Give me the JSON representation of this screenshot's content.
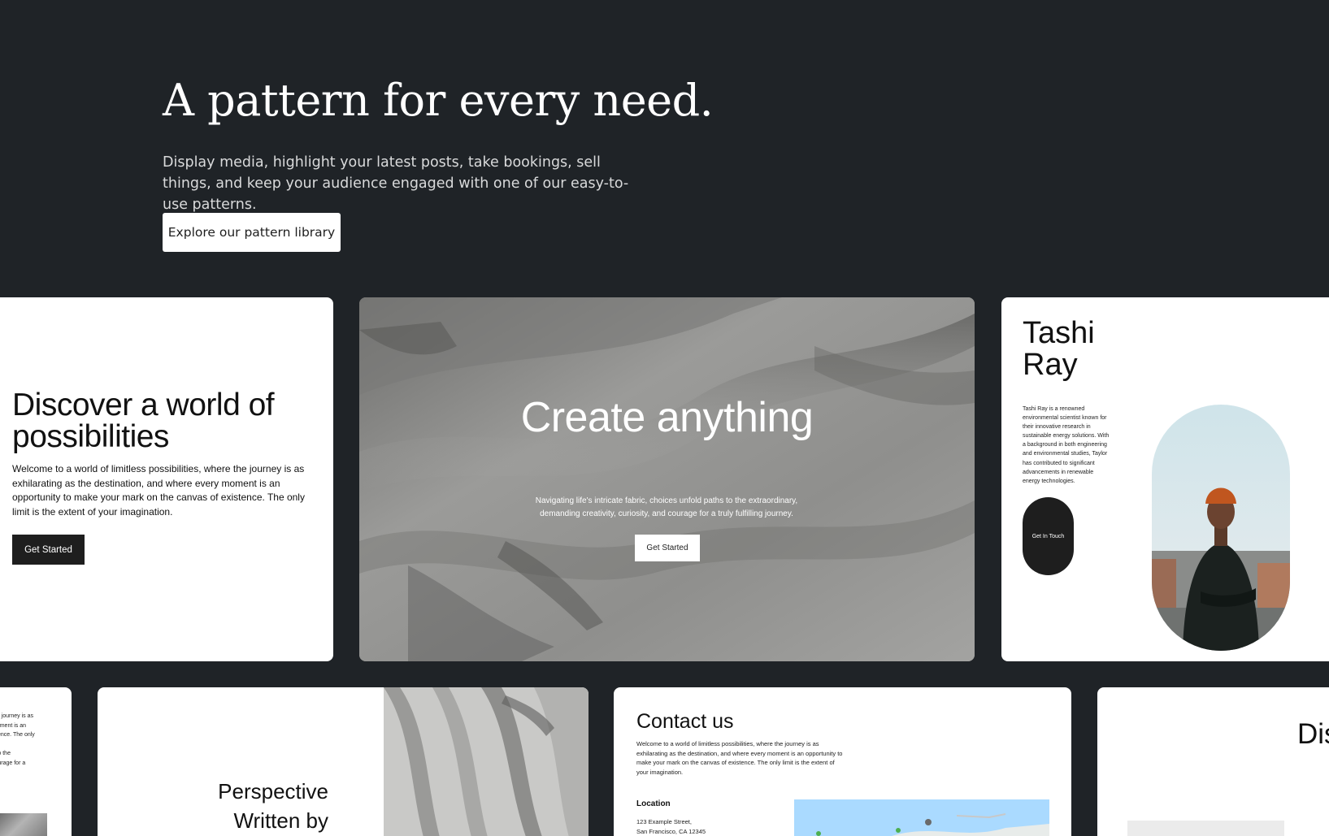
{
  "hero": {
    "title": "A pattern for every need.",
    "description": "Display media, highlight your latest posts, take bookings, sell things, and keep your audience engaged with one of our easy-to-use patterns.",
    "button_label": "Explore our pattern library"
  },
  "patterns": {
    "discover": {
      "title": "Discover a world of possibilities",
      "body": "Welcome to a world of limitless possibilities, where the journey is as exhilarating as the destination, and where every moment is an opportunity to make your mark on the canvas of existence. The only limit is the extent of your imagination.",
      "button_label": "Get Started"
    },
    "create": {
      "title": "Create anything",
      "body": "Navigating life's intricate fabric, choices unfold paths to the extraordinary, demanding creativity, curiosity, and courage for a truly fulfilling journey.",
      "button_label": "Get Started"
    },
    "profile": {
      "name": "Tashi Ray",
      "bio": "Tashi Ray is a renowned environmental scientist known for their innovative research in sustainable energy solutions. With a background in both engineering and environmental studies, Taylor has contributed to significant advancements in renewable energy technologies.",
      "button_label": "Get In Touch"
    },
    "partial_text": {
      "body": "the journey is as\nmoment is an\nistence. The only\n\ns to the\ncourage for a"
    },
    "perspective": {
      "title": "Perspective\nWritten by"
    },
    "contact": {
      "title": "Contact us",
      "body": "Welcome to a world of limitless possibilities, where the journey is as exhilarating as the destination, and where every moment is an opportunity to make your mark on the canvas of existence. The only limit is the extent of your imagination.",
      "location_heading": "Location",
      "address": "123 Example Street,\nSan Francisco, CA 12345"
    },
    "dis": {
      "title": "Dis"
    }
  },
  "colors": {
    "background": "#1f2327",
    "card": "#ffffff",
    "dark_button": "#1e1e1e"
  }
}
